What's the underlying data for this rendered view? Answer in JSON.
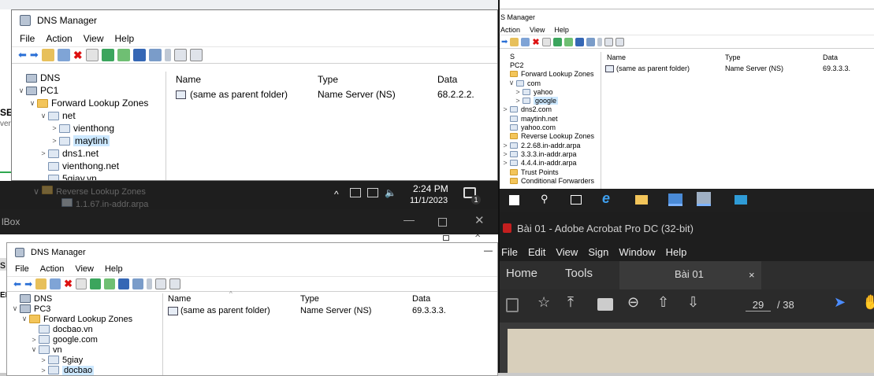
{
  "w1": {
    "title": "DNS Manager",
    "menu": [
      "File",
      "Action",
      "View",
      "Help"
    ],
    "tree": [
      {
        "label": "DNS",
        "lvl": 0,
        "tw": "",
        "icon": "srv"
      },
      {
        "label": "PC1",
        "lvl": 0,
        "tw": "∨",
        "icon": "srv"
      },
      {
        "label": "Forward Lookup Zones",
        "lvl": 1,
        "tw": "∨",
        "icon": "fold"
      },
      {
        "label": "net",
        "lvl": 2,
        "tw": "∨",
        "icon": "zone"
      },
      {
        "label": "vienthong",
        "lvl": 3,
        "tw": ">",
        "icon": "zone"
      },
      {
        "label": "maytinh",
        "lvl": 3,
        "tw": ">",
        "icon": "zone",
        "sel": true
      },
      {
        "label": "dns1.net",
        "lvl": 2,
        "tw": ">",
        "icon": "zone"
      },
      {
        "label": "vienthong.net",
        "lvl": 2,
        "tw": "",
        "icon": "zone"
      },
      {
        "label": "5giay.vn",
        "lvl": 2,
        "tw": "",
        "icon": "zone"
      }
    ],
    "cols": [
      "Name",
      "Type",
      "Data"
    ],
    "row": {
      "name": "(same as parent folder)",
      "type": "Name Server (NS)",
      "data": "68.2.2.2."
    },
    "hidden_tree": [
      "Reverse Lookup Zones",
      "1.1.67.in-addr.arpa"
    ]
  },
  "w1_edge": {
    "t1": "SE",
    "t2": "ver"
  },
  "taskbar1": {
    "time": "2:24 PM",
    "date": "11/1/2023",
    "badge": "1"
  },
  "vbox": {
    "title": "lBox"
  },
  "w3": {
    "title": "DNS Manager",
    "menu": [
      "File",
      "Action",
      "View",
      "Help"
    ],
    "tree": [
      {
        "label": "DNS",
        "lvl": 0,
        "tw": "",
        "icon": "srv"
      },
      {
        "label": "PC3",
        "lvl": 0,
        "tw": "∨",
        "icon": "srv"
      },
      {
        "label": "Forward Lookup Zones",
        "lvl": 1,
        "tw": "∨",
        "icon": "fold"
      },
      {
        "label": "docbao.vn",
        "lvl": 2,
        "tw": "",
        "icon": "zone"
      },
      {
        "label": "google.com",
        "lvl": 2,
        "tw": ">",
        "icon": "zone"
      },
      {
        "label": "vn",
        "lvl": 2,
        "tw": "∨",
        "icon": "zone"
      },
      {
        "label": "5giay",
        "lvl": 3,
        "tw": ">",
        "icon": "zone"
      },
      {
        "label": "docbao",
        "lvl": 3,
        "tw": ">",
        "icon": "zone",
        "sel": true
      }
    ],
    "cols": [
      "Name",
      "Type",
      "Data"
    ],
    "row": {
      "name": "(same as parent folder)",
      "type": "Name Server (NS)",
      "data": "69.3.3.3."
    },
    "left_edge": {
      "t1": "sh",
      "t2": "ERV"
    }
  },
  "w2": {
    "title": "S Manager",
    "menu": [
      "Action",
      "View",
      "Help"
    ],
    "tree": [
      {
        "label": "S",
        "lvl": 0,
        "tw": "",
        "icon": ""
      },
      {
        "label": "PC2",
        "lvl": 0,
        "tw": "",
        "icon": ""
      },
      {
        "label": "Forward Lookup Zones",
        "lvl": 0,
        "tw": "",
        "icon": "fold"
      },
      {
        "label": "com",
        "lvl": 1,
        "tw": "∨",
        "icon": "zone"
      },
      {
        "label": "yahoo",
        "lvl": 2,
        "tw": ">",
        "icon": "zone"
      },
      {
        "label": "google",
        "lvl": 2,
        "tw": ">",
        "icon": "zone",
        "sel": true
      },
      {
        "label": "dns2.com",
        "lvl": 0,
        "tw": ">",
        "icon": "zone"
      },
      {
        "label": "maytinh.net",
        "lvl": 0,
        "tw": "",
        "icon": "zone"
      },
      {
        "label": "yahoo.com",
        "lvl": 0,
        "tw": "",
        "icon": "zone"
      },
      {
        "label": "Reverse Lookup Zones",
        "lvl": 0,
        "tw": "",
        "icon": "fold"
      },
      {
        "label": "2.2.68.in-addr.arpa",
        "lvl": 0,
        "tw": ">",
        "icon": "zone"
      },
      {
        "label": "3.3.3.in-addr.arpa",
        "lvl": 0,
        "tw": ">",
        "icon": "zone"
      },
      {
        "label": "4.4.4.in-addr.arpa",
        "lvl": 0,
        "tw": ">",
        "icon": "zone"
      },
      {
        "label": "Trust Points",
        "lvl": 0,
        "tw": "",
        "icon": "fold"
      },
      {
        "label": "Conditional Forwarders",
        "lvl": 0,
        "tw": "",
        "icon": "fold"
      }
    ],
    "cols": [
      "Name",
      "Type",
      "Data"
    ],
    "row": {
      "name": "(same as parent folder)",
      "type": "Name Server (NS)",
      "data": "69.3.3.3."
    }
  },
  "acrobat": {
    "title": "Bài 01 - Adobe Acrobat Pro DC (32-bit)",
    "menu": [
      "File",
      "Edit",
      "View",
      "Sign",
      "Window",
      "Help"
    ],
    "home": "Home",
    "tools": "Tools",
    "tab": "Bài 01",
    "close": "×",
    "page": "29",
    "total": "/ 38"
  }
}
